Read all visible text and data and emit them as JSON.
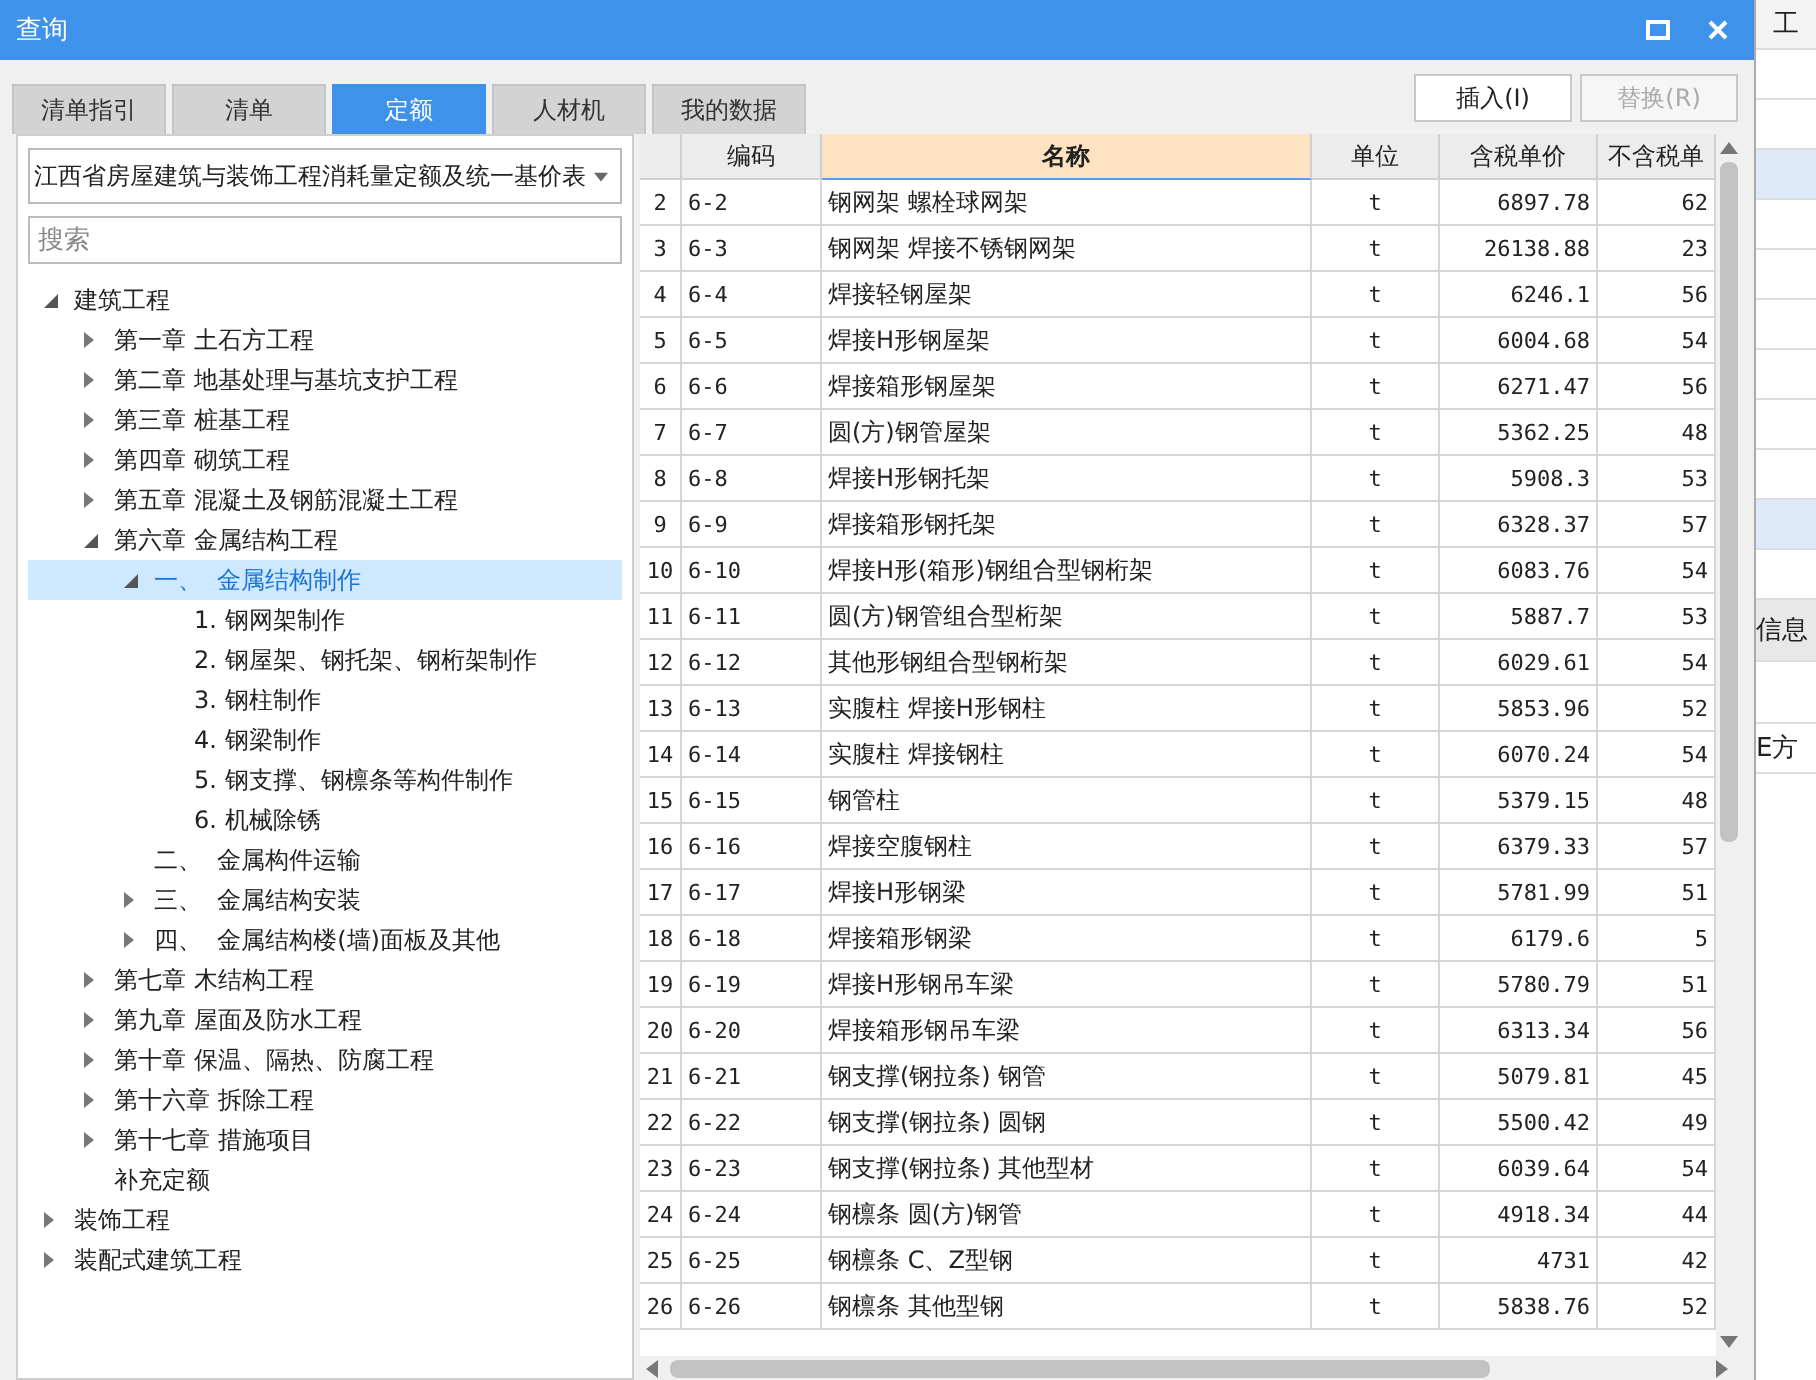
{
  "window": {
    "title": "查询"
  },
  "tabs": [
    {
      "label": "清单指引",
      "selected": false
    },
    {
      "label": "清单",
      "selected": false
    },
    {
      "label": "定额",
      "selected": true
    },
    {
      "label": "人材机",
      "selected": false
    },
    {
      "label": "我的数据",
      "selected": false
    }
  ],
  "buttons": [
    {
      "label": "插入(I)",
      "disabled": false
    },
    {
      "label": "替换(R)",
      "disabled": true
    }
  ],
  "library_select": {
    "value": "江西省房屋建筑与装饰工程消耗量定额及统一基价表"
  },
  "search": {
    "placeholder": "搜索"
  },
  "tree": [
    {
      "label": "建筑工程",
      "expanded": true,
      "selected": false,
      "children": [
        {
          "label": "第一章 土石方工程",
          "expanded": false,
          "selected": false
        },
        {
          "label": "第二章 地基处理与基坑支护工程",
          "expanded": false,
          "selected": false
        },
        {
          "label": "第三章 桩基工程",
          "expanded": false,
          "selected": false
        },
        {
          "label": "第四章 砌筑工程",
          "expanded": false,
          "selected": false
        },
        {
          "label": "第五章 混凝土及钢筋混凝土工程",
          "expanded": false,
          "selected": false
        },
        {
          "label": "第六章 金属结构工程",
          "expanded": true,
          "selected": false,
          "children": [
            {
              "label": "一、  金属结构制作",
              "expanded": true,
              "selected": true,
              "children": [
                {
                  "label": "1. 钢网架制作",
                  "selected": false
                },
                {
                  "label": "2. 钢屋架、钢托架、钢桁架制作",
                  "selected": false
                },
                {
                  "label": "3. 钢柱制作",
                  "selected": false
                },
                {
                  "label": "4. 钢梁制作",
                  "selected": false
                },
                {
                  "label": "5. 钢支撑、钢檩条等构件制作",
                  "selected": false
                },
                {
                  "label": "6. 机械除锈",
                  "selected": false
                }
              ]
            },
            {
              "label": "二、  金属构件运输",
              "selected": false
            },
            {
              "label": "三、  金属结构安装",
              "expanded": false,
              "selected": false
            },
            {
              "label": "四、  金属结构楼(墙)面板及其他",
              "expanded": false,
              "selected": false
            }
          ]
        },
        {
          "label": "第七章 木结构工程",
          "expanded": false,
          "selected": false
        },
        {
          "label": "第九章 屋面及防水工程",
          "expanded": false,
          "selected": false
        },
        {
          "label": "第十章 保温、隔热、防腐工程",
          "expanded": false,
          "selected": false
        },
        {
          "label": "第十六章 拆除工程",
          "expanded": false,
          "selected": false
        },
        {
          "label": "第十七章 措施项目",
          "expanded": false,
          "selected": false
        },
        {
          "label": "补充定额",
          "selected": false
        }
      ]
    },
    {
      "label": "装饰工程",
      "expanded": false,
      "selected": false
    },
    {
      "label": "装配式建筑工程",
      "expanded": false,
      "selected": false
    }
  ],
  "table": {
    "columns": [
      {
        "label": "编码",
        "selected": false
      },
      {
        "label": "名称",
        "selected": true
      },
      {
        "label": "单位",
        "selected": false
      },
      {
        "label": "含税单价",
        "selected": false
      },
      {
        "label": "不含税单",
        "selected": false
      }
    ],
    "rows": [
      {
        "row_number": "2",
        "cells": [
          "6-2",
          "钢网架 螺栓球网架",
          "t",
          "6897.78",
          "62"
        ]
      },
      {
        "row_number": "3",
        "cells": [
          "6-3",
          "钢网架 焊接不锈钢网架",
          "t",
          "26138.88",
          "23"
        ]
      },
      {
        "row_number": "4",
        "cells": [
          "6-4",
          "焊接轻钢屋架",
          "t",
          "6246.1",
          "56"
        ]
      },
      {
        "row_number": "5",
        "cells": [
          "6-5",
          "焊接H形钢屋架",
          "t",
          "6004.68",
          "54"
        ]
      },
      {
        "row_number": "6",
        "cells": [
          "6-6",
          "焊接箱形钢屋架",
          "t",
          "6271.47",
          "56"
        ]
      },
      {
        "row_number": "7",
        "cells": [
          "6-7",
          "圆(方)钢管屋架",
          "t",
          "5362.25",
          "48"
        ]
      },
      {
        "row_number": "8",
        "cells": [
          "6-8",
          "焊接H形钢托架",
          "t",
          "5908.3",
          "53"
        ]
      },
      {
        "row_number": "9",
        "cells": [
          "6-9",
          "焊接箱形钢托架",
          "t",
          "6328.37",
          "57"
        ]
      },
      {
        "row_number": "10",
        "cells": [
          "6-10",
          "焊接H形(箱形)钢组合型钢桁架",
          "t",
          "6083.76",
          "54"
        ]
      },
      {
        "row_number": "11",
        "cells": [
          "6-11",
          "圆(方)钢管组合型桁架",
          "t",
          "5887.7",
          "53"
        ]
      },
      {
        "row_number": "12",
        "cells": [
          "6-12",
          "其他形钢组合型钢桁架",
          "t",
          "6029.61",
          "54"
        ]
      },
      {
        "row_number": "13",
        "cells": [
          "6-13",
          "实腹柱 焊接H形钢柱",
          "t",
          "5853.96",
          "52"
        ]
      },
      {
        "row_number": "14",
        "cells": [
          "6-14",
          "实腹柱 焊接钢柱",
          "t",
          "6070.24",
          "54"
        ]
      },
      {
        "row_number": "15",
        "cells": [
          "6-15",
          "钢管柱",
          "t",
          "5379.15",
          "48"
        ]
      },
      {
        "row_number": "16",
        "cells": [
          "6-16",
          "焊接空腹钢柱",
          "t",
          "6379.33",
          "57"
        ]
      },
      {
        "row_number": "17",
        "cells": [
          "6-17",
          "焊接H形钢梁",
          "t",
          "5781.99",
          "51"
        ]
      },
      {
        "row_number": "18",
        "cells": [
          "6-18",
          "焊接箱形钢梁",
          "t",
          "6179.6",
          "5"
        ]
      },
      {
        "row_number": "19",
        "cells": [
          "6-19",
          "焊接H形钢吊车梁",
          "t",
          "5780.79",
          "51"
        ]
      },
      {
        "row_number": "20",
        "cells": [
          "6-20",
          "焊接箱形钢吊车梁",
          "t",
          "6313.34",
          "56"
        ]
      },
      {
        "row_number": "21",
        "cells": [
          "6-21",
          "钢支撑(钢拉条) 钢管",
          "t",
          "5079.81",
          "45"
        ]
      },
      {
        "row_number": "22",
        "cells": [
          "6-22",
          "钢支撑(钢拉条) 圆钢",
          "t",
          "5500.42",
          "49"
        ]
      },
      {
        "row_number": "23",
        "cells": [
          "6-23",
          "钢支撑(钢拉条) 其他型材",
          "t",
          "6039.64",
          "54"
        ]
      },
      {
        "row_number": "24",
        "cells": [
          "6-24",
          "钢檩条 圆(方)钢管",
          "t",
          "4918.34",
          "44"
        ]
      },
      {
        "row_number": "25",
        "cells": [
          "6-25",
          "钢檩条 C、Z型钢",
          "t",
          "4731",
          "42"
        ]
      },
      {
        "row_number": "26",
        "cells": [
          "6-26",
          "钢檩条 其他型钢",
          "t",
          "5838.76",
          "52"
        ]
      }
    ]
  },
  "background_window": {
    "texts": [
      "工",
      "信息",
      "E方"
    ]
  }
}
